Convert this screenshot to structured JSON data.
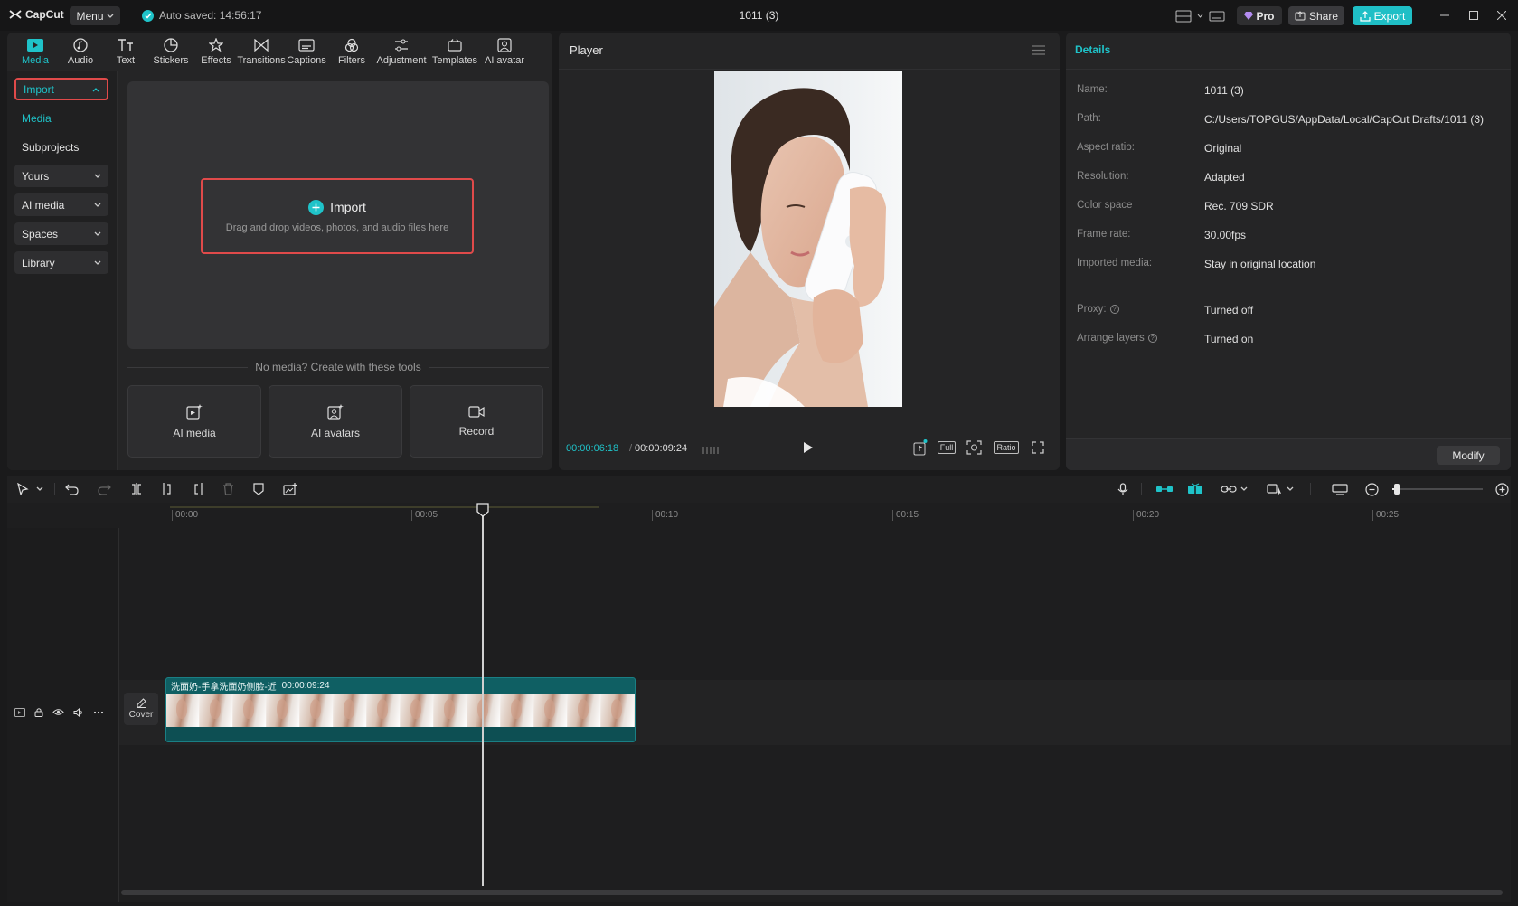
{
  "app": {
    "brand": "CapCut",
    "menu_label": "Menu",
    "autosave": "Auto saved: 14:56:17",
    "project_title": "1011 (3)",
    "pro_label": "Pro",
    "share_label": "Share",
    "export_label": "Export",
    "accent": "#1fc3c9"
  },
  "tool_tabs": [
    {
      "label": "Media",
      "icon": "media-icon",
      "active": true
    },
    {
      "label": "Audio",
      "icon": "audio-icon"
    },
    {
      "label": "Text",
      "icon": "text-icon"
    },
    {
      "label": "Stickers",
      "icon": "sticker-icon"
    },
    {
      "label": "Effects",
      "icon": "effects-icon"
    },
    {
      "label": "Transitions",
      "icon": "transitions-icon"
    },
    {
      "label": "Captions",
      "icon": "captions-icon"
    },
    {
      "label": "Filters",
      "icon": "filters-icon"
    },
    {
      "label": "Adjustment",
      "icon": "adjustment-icon"
    },
    {
      "label": "Templates",
      "icon": "templates-icon"
    },
    {
      "label": "AI avatar",
      "icon": "ai-avatar-icon"
    }
  ],
  "side_nav": {
    "import": "Import",
    "media": "Media",
    "subprojects": "Subprojects",
    "yours": "Yours",
    "ai_media": "AI media",
    "spaces": "Spaces",
    "library": "Library"
  },
  "import_area": {
    "button_label": "Import",
    "hint": "Drag and drop videos, photos, and audio files here",
    "no_media": "No media? Create with these tools"
  },
  "create_tools": {
    "ai_media": "AI media",
    "ai_avatars": "AI avatars",
    "record": "Record"
  },
  "player": {
    "title": "Player",
    "current_time": "00:00:06:18",
    "separator": "/",
    "duration": "00:00:09:24",
    "full_label": "Full",
    "ratio_label": "Ratio"
  },
  "details": {
    "title": "Details",
    "rows": [
      {
        "label": "Name:",
        "value": "1011 (3)"
      },
      {
        "label": "Path:",
        "value": "C:/Users/TOPGUS/AppData/Local/CapCut Drafts/1011 (3)"
      },
      {
        "label": "Aspect ratio:",
        "value": "Original"
      },
      {
        "label": "Resolution:",
        "value": "Adapted"
      },
      {
        "label": "Color space",
        "value": "Rec. 709 SDR"
      },
      {
        "label": "Frame rate:",
        "value": "30.00fps"
      },
      {
        "label": "Imported media:",
        "value": "Stay in original location"
      }
    ],
    "proxy_label": "Proxy:",
    "proxy_value": "Turned off",
    "arrange_label": "Arrange layers",
    "arrange_value": "Turned on",
    "modify_label": "Modify"
  },
  "timeline": {
    "ruler": [
      "00:00",
      "00:05",
      "00:10",
      "00:15",
      "00:20",
      "00:25"
    ],
    "cover_label": "Cover",
    "clip_name": "洗面奶-手拿洗面奶侧脸-近",
    "clip_duration": "00:00:09:24",
    "frame_count": 14,
    "zoom_level": 0.05
  }
}
